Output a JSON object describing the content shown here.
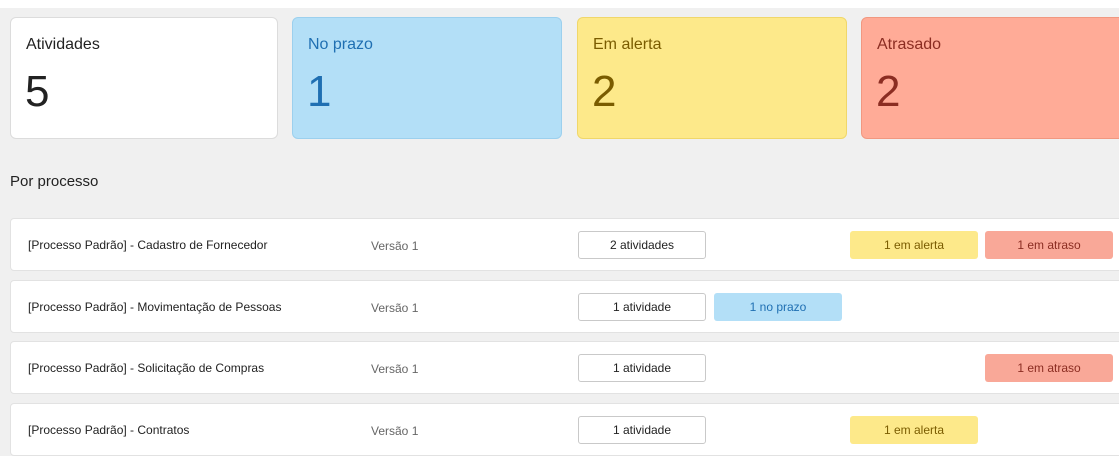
{
  "summary": {
    "total": {
      "label": "Atividades",
      "value": "5"
    },
    "on_time": {
      "label": "No prazo",
      "value": "1"
    },
    "alert": {
      "label": "Em alerta",
      "value": "2"
    },
    "late": {
      "label": "Atrasado",
      "value": "2"
    }
  },
  "section_title": "Por processo",
  "processes": [
    {
      "name": "[Processo Padrão] - Cadastro de Fornecedor",
      "version": "Versão 1",
      "count": "2 atividades",
      "alert": "1 em alerta",
      "late": "1 em atraso"
    },
    {
      "name": "[Processo Padrão] - Movimentação de Pessoas",
      "version": "Versão 1",
      "count": "1 atividade",
      "on_time": "1 no prazo"
    },
    {
      "name": "[Processo Padrão] - Solicitação de Compras",
      "version": "Versão 1",
      "count": "1 atividade",
      "late": "1 em atraso"
    },
    {
      "name": "[Processo Padrão] - Contratos",
      "version": "Versão 1",
      "count": "1 atividade",
      "alert": "1 em alerta"
    }
  ],
  "colors": {
    "on_time": "#b3dff7",
    "alert": "#fde98a",
    "late": "#ffab97"
  }
}
